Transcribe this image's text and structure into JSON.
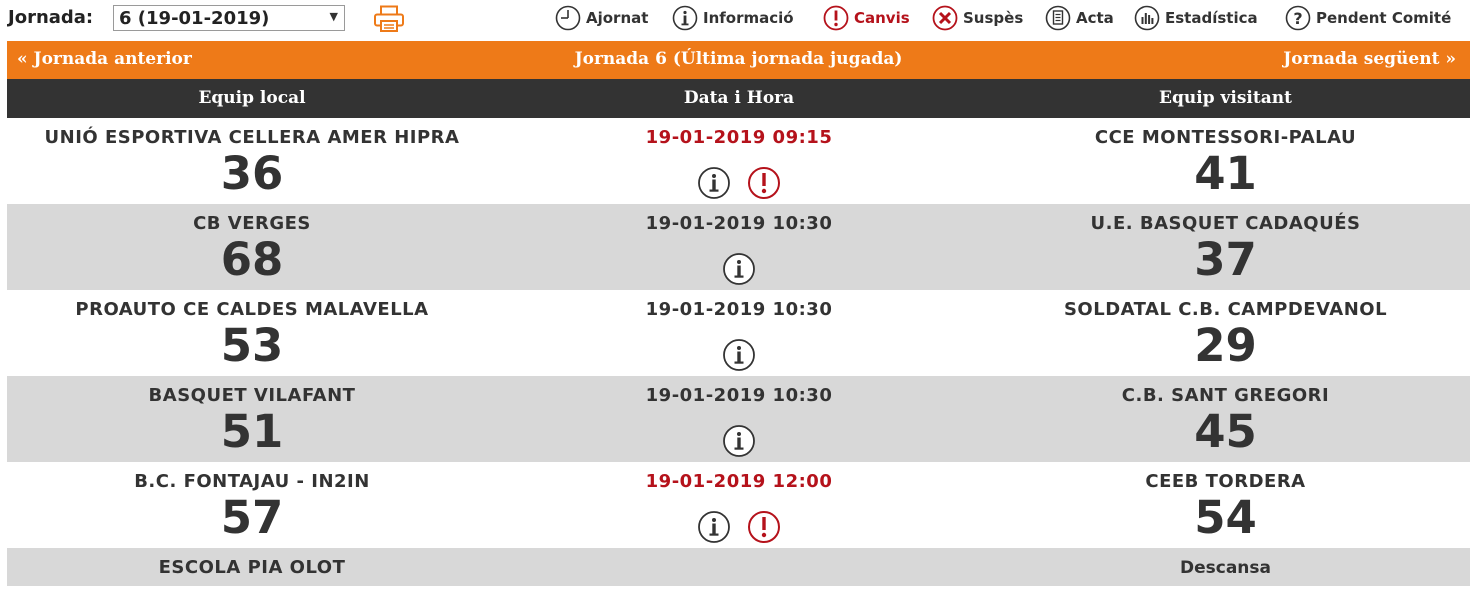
{
  "toolbar": {
    "jornada_label": "Jornada:",
    "jornada_selected": "6 (19-01-2019)",
    "print_icon": "printer-icon",
    "legend": [
      {
        "icon": "clock-icon",
        "label": "Ajornat"
      },
      {
        "icon": "info-icon",
        "label": "Informació"
      },
      {
        "icon": "alert-icon",
        "label": "Canvis"
      },
      {
        "icon": "x-icon",
        "label": "Suspès"
      },
      {
        "icon": "document-icon",
        "label": "Acta"
      },
      {
        "icon": "stats-icon",
        "label": "Estadística"
      },
      {
        "icon": "question-icon",
        "label": "Pendent Comité"
      }
    ]
  },
  "nav": {
    "prev": "«  Jornada anterior",
    "current": "Jornada 6 (Última jornada jugada)",
    "next": "Jornada següent  »"
  },
  "table": {
    "headers": {
      "local": "Equip local",
      "datetime": "Data i Hora",
      "away": "Equip visitant"
    },
    "matches": [
      {
        "local": "UNIÓ ESPORTIVA CELLERA AMER HIPRA",
        "local_score": "36",
        "datetime": "19-01-2019 09:15",
        "changed": true,
        "away": "CCE MONTESSORI-PALAU",
        "away_score": "41"
      },
      {
        "local": "CB VERGES",
        "local_score": "68",
        "datetime": "19-01-2019 10:30",
        "changed": false,
        "away": "U.E. BASQUET CADAQUÉS",
        "away_score": "37"
      },
      {
        "local": "PROAUTO CE CALDES MALAVELLA",
        "local_score": "53",
        "datetime": "19-01-2019 10:30",
        "changed": false,
        "away": "SOLDATAL C.B. CAMPDEVANOL",
        "away_score": "29"
      },
      {
        "local": "BASQUET VILAFANT",
        "local_score": "51",
        "datetime": "19-01-2019 10:30",
        "changed": false,
        "away": "C.B. SANT GREGORI",
        "away_score": "45"
      },
      {
        "local": "B.C. FONTAJAU - IN2IN",
        "local_score": "57",
        "datetime": "19-01-2019 12:00",
        "changed": true,
        "away": "CEEB TORDERA",
        "away_score": "54"
      }
    ],
    "bye": {
      "team": "ESCOLA PIA OLOT",
      "label": "Descansa"
    }
  },
  "colors": {
    "accent": "#ee7a18",
    "header_bg": "#333333",
    "alt_row": "#d8d8d8",
    "changed_red": "#b5121b"
  }
}
